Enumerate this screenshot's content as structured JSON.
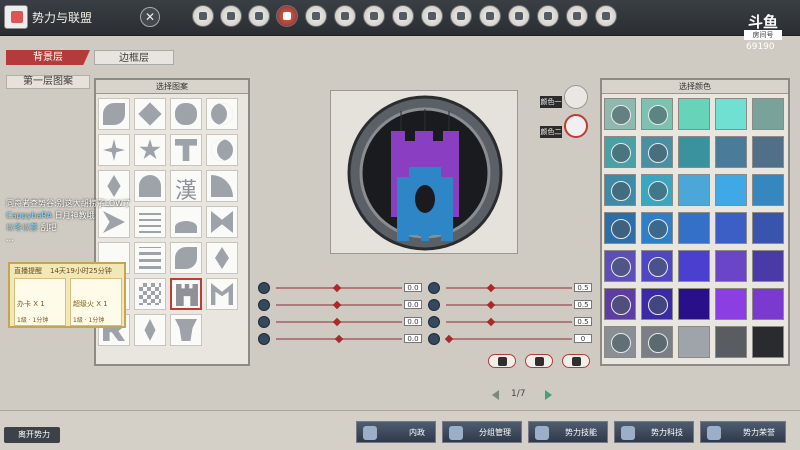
{
  "header": {
    "title": "势力与联盟",
    "close": "✕",
    "stream_logo": "斗鱼",
    "room_label": "房间号",
    "room_number": "69190",
    "icons": [
      "icon-1",
      "icon-2",
      "icon-3",
      "icon-4",
      "icon-5",
      "icon-6",
      "icon-7",
      "icon-8",
      "icon-9",
      "icon-10",
      "icon-11",
      "icon-12",
      "icon-13",
      "icon-14",
      "icon-15"
    ]
  },
  "tabs": {
    "background": "背景层",
    "border": "边框层"
  },
  "layer_label": "第一层图案",
  "pattern_panel": {
    "title": "选择图案",
    "text_glyph": "漢"
  },
  "color_panel": {
    "title": "选择颜色",
    "colors": [
      "#8fb9ae",
      "#7bc3b0",
      "#67d3b8",
      "#6fe0d2",
      "#79a39a",
      "#49a1a6",
      "#4a8fa2",
      "#39929e",
      "#4a7c9a",
      "#526f8a",
      "#3f8aa6",
      "#3aa6c0",
      "#4aa7d8",
      "#3fa8e6",
      "#3587c0",
      "#2d6ea8",
      "#2e7ec8",
      "#3470c8",
      "#3b5fc4",
      "#3954ad",
      "#5e4fb8",
      "#4e46c3",
      "#4b3fd0",
      "#6a45c8",
      "#4a3aa8",
      "#5d3ca3",
      "#3a2aa7",
      "#2a0f8a",
      "#8b3fe3",
      "#7a3ad0",
      "#8a8f94",
      "#7a7f85",
      "#9ea4a9",
      "#595c60",
      "#2a2b2e"
    ]
  },
  "color_slots": {
    "color1_label": "颜色一",
    "color2_label": "颜色二"
  },
  "sliders": [
    {
      "value": "0.0",
      "position": 0.48
    },
    {
      "value": "0.0",
      "position": 0.48
    },
    {
      "value": "0.0",
      "position": 0.48
    },
    {
      "value": "0.0",
      "position": 0.5
    },
    {
      "value": "0.5",
      "position": 0.35
    },
    {
      "value": "0.5",
      "position": 0.35
    },
    {
      "value": "0.5",
      "position": 0.35
    },
    {
      "value": "0",
      "position": 0.0
    }
  ],
  "pagination": {
    "page": "1/7"
  },
  "bottom_nav": {
    "leave": "离开势力",
    "items": [
      "内政",
      "分组管理",
      "势力技能",
      "势力科技",
      "势力荣誉"
    ]
  },
  "chat": [
    {
      "name": "",
      "text": "同舟者查势谷:别这大胡捞子LOW了"
    },
    {
      "name": "CappybaRA",
      "text": "日月神教哦"
    },
    {
      "name": "以冬以茶",
      "text": "刮吧"
    },
    {
      "name": "",
      "text": "..."
    }
  ],
  "live_card": {
    "title": "直播提醒",
    "time": "14天19小时25分钟",
    "gifts": [
      {
        "name": "办卡 X 1",
        "info": "1级 · 1分钟"
      },
      {
        "name": "超级火 X 1",
        "info": "1级 · 1分钟"
      }
    ]
  }
}
